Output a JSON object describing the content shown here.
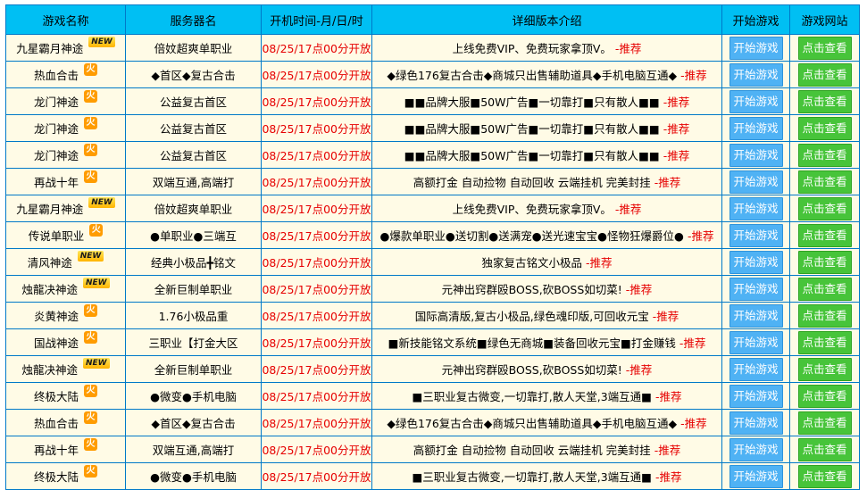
{
  "headers": [
    "游戏名称",
    "服务器名",
    "开机时间-月/日/时",
    "详细版本介绍",
    "开始游戏",
    "游戏网站"
  ],
  "badge_labels": {
    "new": "NEW",
    "hot": "火"
  },
  "colors": {
    "header_bg": "#00bff3",
    "row_bg": "#fffbe6",
    "border": "#0079c8",
    "time": "#e60000",
    "start_btn": "#4fb2f4",
    "view_btn": "#47c43a"
  },
  "rows": [
    {
      "game": "九星霸月神途",
      "badge": "new",
      "server": "倍妏超爽单职业",
      "time": "08/25/17点00分开放",
      "desc": "上线免费VIP、免费玩家拿顶V。",
      "recommend": "-推荐",
      "start": "开始游戏",
      "view": "点击查看"
    },
    {
      "game": "热血合击",
      "badge": "hot",
      "server": "◆首区◆复古合击",
      "time": "08/25/17点00分开放",
      "desc": "◆绿色176复古合击◆商城只出售辅助道具◆手机电脑互通◆",
      "recommend": "-推荐",
      "start": "开始游戏",
      "view": "点击查看"
    },
    {
      "game": "龙门神途",
      "badge": "hot",
      "server": "公益复古首区",
      "time": "08/25/17点00分开放",
      "desc": "■■品牌大服■50W广告■一切靠打■只有散人■■",
      "recommend": "-推荐",
      "start": "开始游戏",
      "view": "点击查看"
    },
    {
      "game": "龙门神途",
      "badge": "hot",
      "server": "公益复古首区",
      "time": "08/25/17点00分开放",
      "desc": "■■品牌大服■50W广告■一切靠打■只有散人■■",
      "recommend": "-推荐",
      "start": "开始游戏",
      "view": "点击查看"
    },
    {
      "game": "龙门神途",
      "badge": "hot",
      "server": "公益复古首区",
      "time": "08/25/17点00分开放",
      "desc": "■■品牌大服■50W广告■一切靠打■只有散人■■",
      "recommend": "-推荐",
      "start": "开始游戏",
      "view": "点击查看"
    },
    {
      "game": "再战十年",
      "badge": "hot",
      "server": "双端互通,高端打",
      "time": "08/25/17点00分开放",
      "desc": "高额打金 自动捡物 自动回收 云端挂机 完美封挂",
      "recommend": "-推荐",
      "start": "开始游戏",
      "view": "点击查看"
    },
    {
      "game": "九星霸月神途",
      "badge": "new",
      "server": "倍妏超爽单职业",
      "time": "08/25/17点00分开放",
      "desc": "上线免费VIP、免费玩家拿顶V。",
      "recommend": "-推荐",
      "start": "开始游戏",
      "view": "点击查看"
    },
    {
      "game": "传说单职业",
      "badge": "hot",
      "server": "●单职业●三端互",
      "time": "08/25/17点00分开放",
      "desc": "●爆款单职业●送切割●送满宠●送光速宝宝●怪物狂爆爵位●",
      "recommend": "-推荐",
      "start": "开始游戏",
      "view": "点击查看"
    },
    {
      "game": "清风神途",
      "badge": "new",
      "server": "经典小极品╋铭文",
      "time": "08/25/17点00分开放",
      "desc": "独家复古铭文小极品",
      "recommend": "-推荐",
      "start": "开始游戏",
      "view": "点击查看"
    },
    {
      "game": "烛龍决神途",
      "badge": "new",
      "server": "全新巨制单职业",
      "time": "08/25/17点00分开放",
      "desc": "元神出窍群殴BOSS,砍BOSS如切菜!",
      "recommend": "-推荐",
      "start": "开始游戏",
      "view": "点击查看"
    },
    {
      "game": "炎黄神途",
      "badge": "hot",
      "server": "1.76小极品重",
      "time": "08/25/17点00分开放",
      "desc": "国际高清版,复古小极品,绿色魂印版,可回收元宝",
      "recommend": "-推荐",
      "start": "开始游戏",
      "view": "点击查看"
    },
    {
      "game": "国战神途",
      "badge": "hot",
      "server": "三职业【打金大区",
      "time": "08/25/17点00分开放",
      "desc": "■新技能铭文系统■绿色无商城■装备回收元宝■打金赚钱",
      "recommend": "-推荐",
      "start": "开始游戏",
      "view": "点击查看"
    },
    {
      "game": "烛龍决神途",
      "badge": "new",
      "server": "全新巨制单职业",
      "time": "08/25/17点00分开放",
      "desc": "元神出窍群殴BOSS,砍BOSS如切菜!",
      "recommend": "-推荐",
      "start": "开始游戏",
      "view": "点击查看"
    },
    {
      "game": "终极大陆",
      "badge": "hot",
      "server": "●微变●手机电脑",
      "time": "08/25/17点00分开放",
      "desc": "■三职业复古微变,一切靠打,散人天堂,3端互通■",
      "recommend": "-推荐",
      "start": "开始游戏",
      "view": "点击查看"
    },
    {
      "game": "热血合击",
      "badge": "hot",
      "server": "◆首区◆复古合击",
      "time": "08/25/17点00分开放",
      "desc": "◆绿色176复古合击◆商城只出售辅助道具◆手机电脑互通◆",
      "recommend": "-推荐",
      "start": "开始游戏",
      "view": "点击查看"
    },
    {
      "game": "再战十年",
      "badge": "hot",
      "server": "双端互通,高端打",
      "time": "08/25/17点00分开放",
      "desc": "高额打金 自动捡物 自动回收 云端挂机 完美封挂",
      "recommend": "-推荐",
      "start": "开始游戏",
      "view": "点击查看"
    },
    {
      "game": "终极大陆",
      "badge": "hot",
      "server": "●微变●手机电脑",
      "time": "08/25/17点00分开放",
      "desc": "■三职业复古微变,一切靠打,散人天堂,3端互通■",
      "recommend": "-推荐",
      "start": "开始游戏",
      "view": "点击查看"
    }
  ]
}
